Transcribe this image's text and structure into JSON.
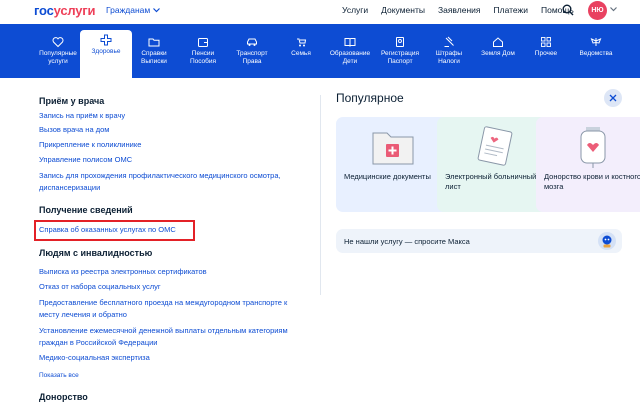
{
  "header": {
    "logo_part1": "гос",
    "logo_part2": "услуги",
    "audience": "Гражданам",
    "nav": [
      "Услуги",
      "Документы",
      "Заявления",
      "Платежи",
      "Помощь"
    ],
    "avatar_initials": "НЮ"
  },
  "categories": [
    {
      "line1": "Популярные",
      "line2": "услуги",
      "icon": "heart-icon"
    },
    {
      "line1": "Здоровье",
      "line2": "",
      "icon": "medical-cross-icon",
      "active": true
    },
    {
      "line1": "Справки",
      "line2": "Выписки",
      "icon": "folder-icon"
    },
    {
      "line1": "Пенсии",
      "line2": "Пособия",
      "icon": "wallet-icon"
    },
    {
      "line1": "Транспорт",
      "line2": "Права",
      "icon": "car-icon"
    },
    {
      "line1": "Семья",
      "line2": "",
      "icon": "stroller-icon"
    },
    {
      "line1": "Образование",
      "line2": "Дети",
      "icon": "book-icon"
    },
    {
      "line1": "Регистрация",
      "line2": "Паспорт",
      "icon": "passport-icon"
    },
    {
      "line1": "Штрафы",
      "line2": "Налоги",
      "icon": "gavel-icon"
    },
    {
      "line1": "Земля Дом",
      "line2": "",
      "icon": "house-icon"
    },
    {
      "line1": "Прочее",
      "line2": "",
      "icon": "grid-icon"
    },
    {
      "line1": "Ведомства",
      "line2": "",
      "icon": "eagle-icon"
    }
  ],
  "left": {
    "section1_title": "Приём у врача",
    "section1_links": [
      "Запись на приём к врачу",
      "Вызов врача на дом",
      "Прикрепление к поликлинике",
      "Управление полисом ОМС",
      "Запись для прохождения профилактического медицинского осмотра, диспансеризации"
    ],
    "section2_title": "Получение сведений",
    "section2_links": [
      "Справка об оказанных услугах по ОМС"
    ],
    "section3_title": "Людям с инвалидностью",
    "section3_links": [
      "Выписка из реестра электронных сертификатов",
      "Отказ от набора социальных услуг",
      "Предоставление бесплатного проезда на междугородном транспорте к месту лечения и обратно",
      "Установление ежемесячной денежной выплаты отдельным категориям граждан в Российской Федерации",
      "Медико-социальная экспертиза"
    ],
    "show_all": "Показать все",
    "section4_title": "Донорство"
  },
  "right": {
    "title": "Популярное",
    "cards": [
      {
        "label": "Медицинские документы",
        "bg": "#e8f0ff"
      },
      {
        "label": "Электронный больничный лист",
        "bg": "#e6f6f2"
      },
      {
        "label": "Донорство крови и костного мозга",
        "bg": "#f3eefc"
      }
    ],
    "max_prompt": "Не нашли услугу — спросите Макса"
  },
  "colors": {
    "brand_blue": "#0d4cd3",
    "brand_red": "#ee3f58",
    "highlight_red": "#e32127"
  }
}
